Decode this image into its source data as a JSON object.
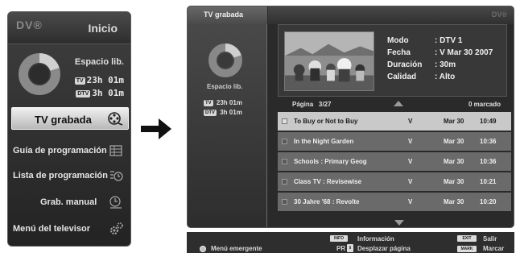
{
  "left_menu": {
    "logo": "DV",
    "title": "Inicio",
    "space_label": "Espacio lib.",
    "tv_badge": "TV",
    "tv_time": "23h 01m",
    "dtv_badge": "DTV",
    "dtv_time": "3h 01m",
    "items": [
      {
        "label": "TV grabada",
        "icon": "film-reel-icon",
        "selected": true
      },
      {
        "label": "Guía de programación",
        "icon": "grid-guide-icon",
        "selected": false
      },
      {
        "label": "Lista de programación",
        "icon": "clock-list-icon",
        "selected": false
      },
      {
        "label": "Grab. manual",
        "icon": "clock-timer-icon",
        "selected": false
      },
      {
        "label": "Menú del televisor",
        "icon": "gear-icon",
        "selected": false
      }
    ]
  },
  "screen": {
    "side_title": "TV grabada",
    "space_label": "Espacio lib.",
    "tv_badge": "TV",
    "tv_time": "23h 01m",
    "dtv_badge": "DTV",
    "dtv_time": "3h 01m",
    "logo": "DV",
    "info": {
      "keys": [
        "Modo",
        "Fecha",
        "Duración",
        "Calidad"
      ],
      "values": [
        ": DTV 1",
        ": V Mar 30 2007",
        ": 30m",
        ": Alto"
      ]
    },
    "page_label": "Página",
    "page_value": "3/27",
    "marked": "0 marcado",
    "recordings": [
      {
        "title": "To Buy or Not to Buy",
        "channel": "V",
        "date": "Mar 30",
        "time": "10:49",
        "selected": true
      },
      {
        "title": "In the Night Garden",
        "channel": "V",
        "date": "Mar 30",
        "time": "10:36",
        "selected": false
      },
      {
        "title": "Schools : Primary Geog",
        "channel": "V",
        "date": "Mar 30",
        "time": "10:36",
        "selected": false
      },
      {
        "title": "Class TV : Revisewise",
        "channel": "V",
        "date": "Mar 30",
        "time": "10:21",
        "selected": false
      },
      {
        "title": "30 Jahre '68 : Revolte",
        "channel": "V",
        "date": "Mar 30",
        "time": "10:20",
        "selected": false
      }
    ]
  },
  "help": {
    "popup": "Menú emergente",
    "info_key": "INFO",
    "info": "Información",
    "pr_key": "PR",
    "move": "Desplazar página",
    "exit_key": "EXIT",
    "exit": "Salir",
    "mark_key": "MARK",
    "mark": "Marcar"
  },
  "colors": {
    "panel": "#2e2e2e",
    "selected_row": "#c9c9c9",
    "row": "#6a6a6a"
  }
}
